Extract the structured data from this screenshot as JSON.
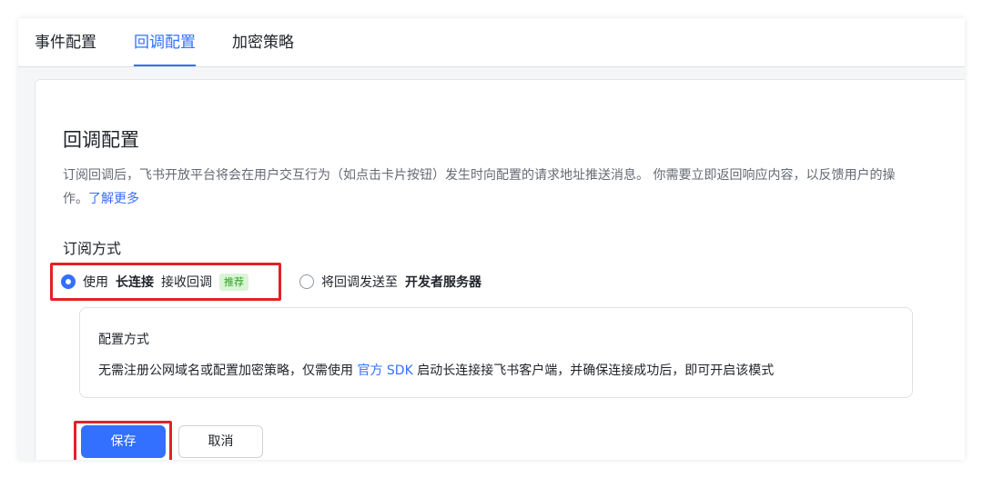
{
  "tabs": [
    {
      "label": "事件配置",
      "active": false
    },
    {
      "label": "回调配置",
      "active": true
    },
    {
      "label": "加密策略",
      "active": false
    }
  ],
  "panel": {
    "title": "回调配置",
    "description": "订阅回调后，飞书开放平台将会在用户交互行为（如点击卡片按钮）发生时向配置的请求地址推送消息。 你需要立即返回响应内容，以反馈用户的操作。",
    "learn_more": "了解更多",
    "subscription_label": "订阅方式",
    "option_long_conn": {
      "prefix": "使用",
      "emphasis": "长连接",
      "suffix": "接收回调",
      "tag": "推荐",
      "checked": true
    },
    "option_server": {
      "prefix": "将回调发送至",
      "emphasis": "开发者服务器",
      "checked": false
    },
    "config_card": {
      "title": "配置方式",
      "text_before": "无需注册公网域名或配置加密策略，仅需使用 ",
      "link": "官方 SDK",
      "text_after": " 启动长连接接飞书客户端，并确保连接成功后，即可开启该模式"
    },
    "save_label": "保存",
    "cancel_label": "取消"
  },
  "colors": {
    "accent": "#3370ff",
    "highlight_border": "#e1212a",
    "tag_bg": "#d9f5d6",
    "tag_text": "#2ea121"
  }
}
